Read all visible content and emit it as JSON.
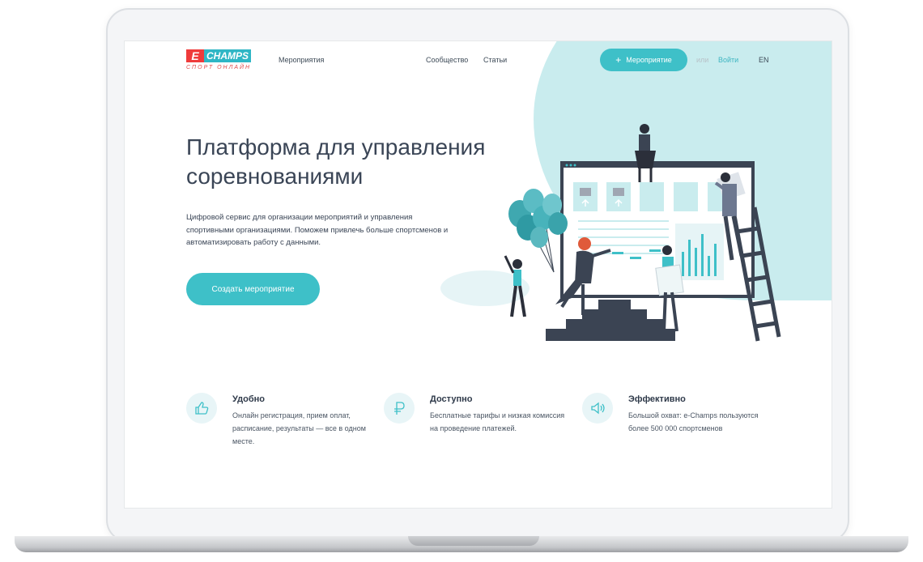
{
  "header": {
    "logo": {
      "mark": "E",
      "name": "CHAMPS",
      "subtitle": "СПОРТ ОНЛАЙН"
    },
    "nav": [
      {
        "label": "Мероприятия"
      },
      {
        "label": "Сообщество"
      },
      {
        "label": "Статьи"
      }
    ],
    "add_event_button": {
      "icon": "+",
      "label": "Мероприятие"
    },
    "or_text": "или",
    "login_label": "Войти",
    "language_label": "EN"
  },
  "hero": {
    "title": "Платформа для управления соревнованиями",
    "description": "Цифровой сервис для организации мероприятий и управления спортивными организациями.  Поможем привлечь больше спортсменов и автоматизировать работу с данными.",
    "cta_label": "Создать мероприятие"
  },
  "features": [
    {
      "icon": "thumbs-up-icon",
      "title": "Удобно",
      "text": "Онлайн регистрация, прием оплат, расписание, результаты — все в одном месте."
    },
    {
      "icon": "ruble-icon",
      "title": "Доступно",
      "text": "Бесплатные тарифы и низкая комиссия на проведение платежей."
    },
    {
      "icon": "megaphone-icon",
      "title": "Эффективно",
      "text": "Большой охват: e-Champs пользуются более 500 000 спортсменов"
    }
  ],
  "colors": {
    "accent": "#3ec0c8",
    "brand_red": "#ef3b3b",
    "brand_teal": "#2fb6c5",
    "heading": "#3a4556",
    "blob": "#c9ecee",
    "illustration_dark": "#3b4453"
  }
}
